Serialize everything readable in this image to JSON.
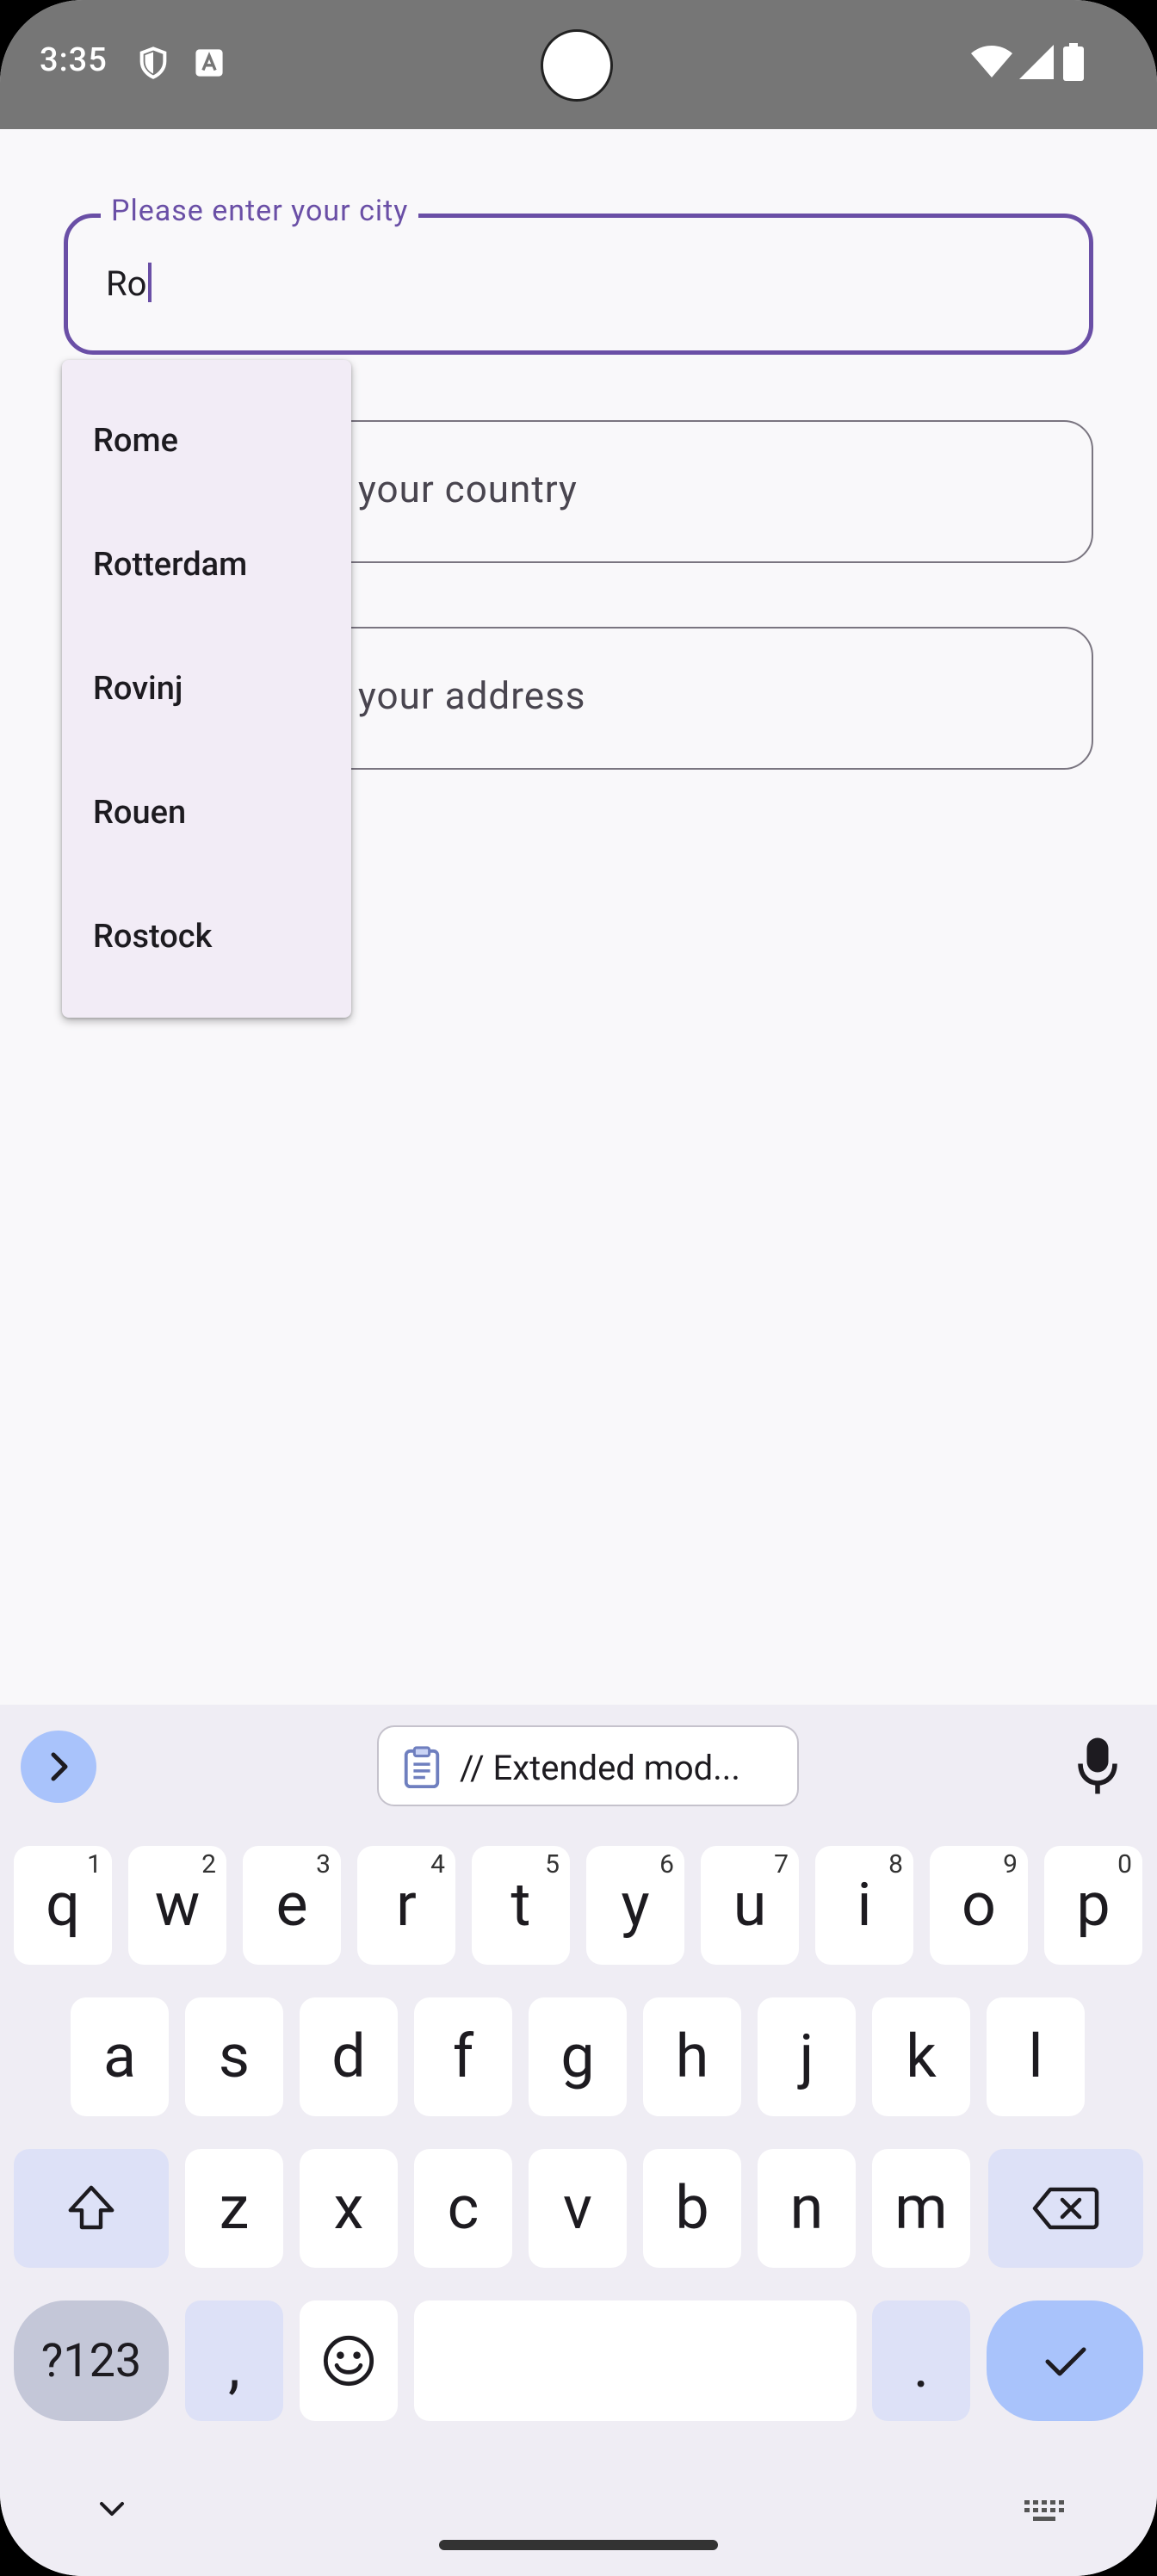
{
  "status_bar": {
    "time": "3:35",
    "icons": [
      "shield-icon",
      "text-a-icon",
      "wifi-icon",
      "signal-icon",
      "battery-icon"
    ]
  },
  "form": {
    "city": {
      "label": "Please enter your city",
      "value": "Ro"
    },
    "country": {
      "placeholder_visible": "your country"
    },
    "address": {
      "placeholder_visible": "your address"
    }
  },
  "dropdown": {
    "items": [
      "Rome",
      "Rotterdam",
      "Rovinj",
      "Rouen",
      "Rostock"
    ]
  },
  "keyboard": {
    "clipboard_chip": "// Extended mod...",
    "row1": [
      {
        "k": "q",
        "h": "1"
      },
      {
        "k": "w",
        "h": "2"
      },
      {
        "k": "e",
        "h": "3"
      },
      {
        "k": "r",
        "h": "4"
      },
      {
        "k": "t",
        "h": "5"
      },
      {
        "k": "y",
        "h": "6"
      },
      {
        "k": "u",
        "h": "7"
      },
      {
        "k": "i",
        "h": "8"
      },
      {
        "k": "o",
        "h": "9"
      },
      {
        "k": "p",
        "h": "0"
      }
    ],
    "row2": [
      "a",
      "s",
      "d",
      "f",
      "g",
      "h",
      "j",
      "k",
      "l"
    ],
    "row3": [
      "z",
      "x",
      "c",
      "v",
      "b",
      "n",
      "m"
    ],
    "symbols_label": "?123",
    "comma": ",",
    "period": "."
  },
  "colors": {
    "accent": "#6a4fa6",
    "status_bar": "#767676",
    "dropdown_bg": "#f2ecf6",
    "keyboard_bg": "#efedf4",
    "enter_key": "#a9c3fb"
  }
}
